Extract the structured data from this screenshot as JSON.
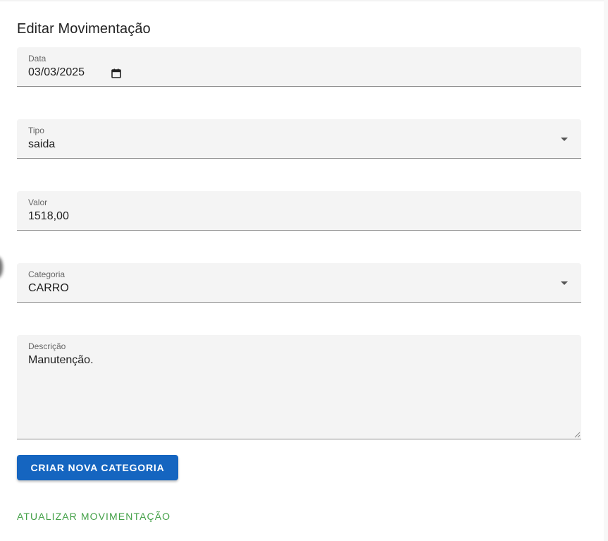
{
  "form": {
    "title": "Editar Movimentação",
    "date": {
      "label": "Data",
      "value": "03/03/2025",
      "icon": "calendar-icon"
    },
    "type": {
      "label": "Tipo",
      "value": "saida",
      "icon": "caret-down-icon"
    },
    "amount": {
      "label": "Valor",
      "value": "1518,00"
    },
    "category": {
      "label": "Categoria",
      "value": "CARRO",
      "icon": "caret-down-icon"
    },
    "description": {
      "label": "Descrição",
      "value": "Manutenção."
    }
  },
  "actions": {
    "create_category_label": "CRIAR NOVA CATEGORIA",
    "update_label": "ATUALIZAR MOVIMENTAÇÃO"
  },
  "colors": {
    "primary": "#1565c0",
    "success": "#43a047",
    "field_bg": "#f4f4f4"
  }
}
